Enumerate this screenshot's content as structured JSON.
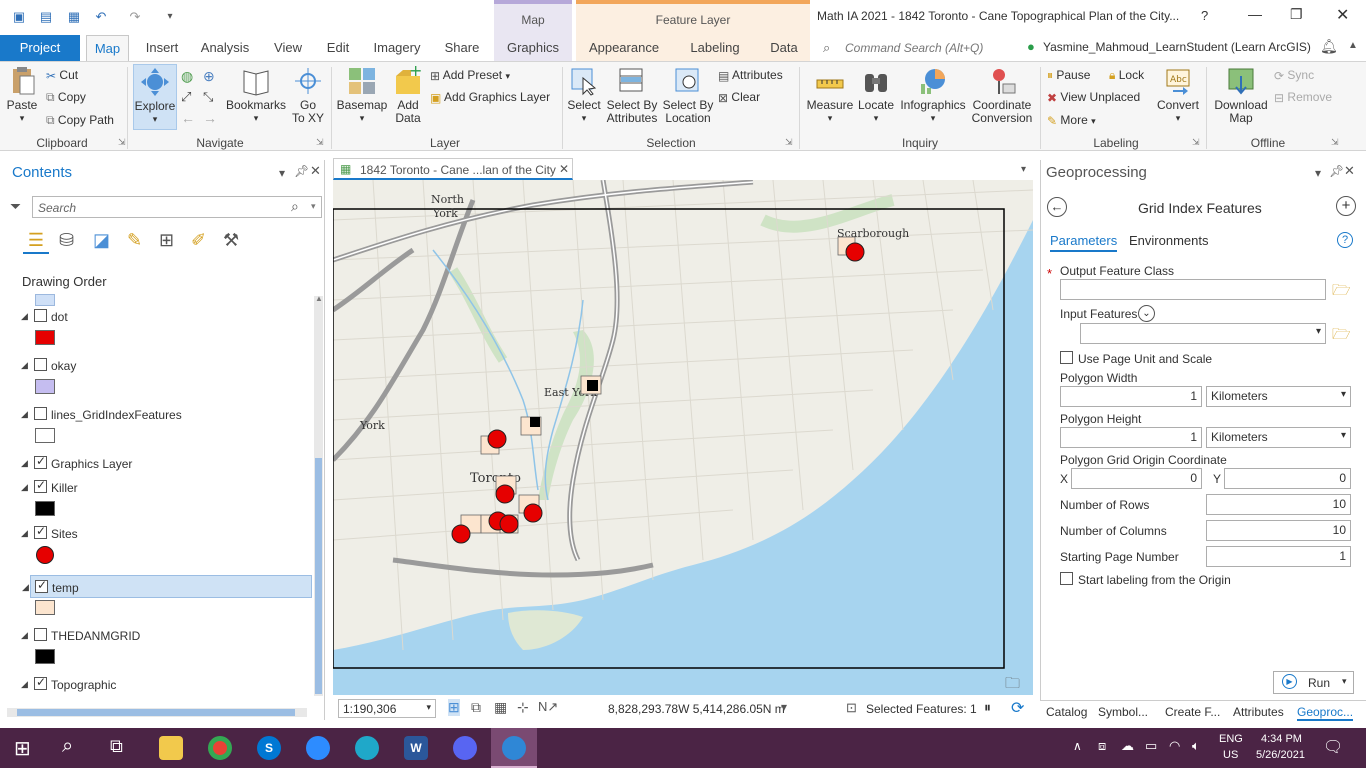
{
  "titlebar": {
    "context_map": "Map",
    "context_feature": "Feature Layer",
    "title": "Math IA 2021 - 1842 Toronto - Cane Topographical Plan of the City...",
    "help": "?"
  },
  "tabs": {
    "project": "Project",
    "map": "Map",
    "insert": "Insert",
    "analysis": "Analysis",
    "view": "View",
    "edit": "Edit",
    "imagery": "Imagery",
    "share": "Share",
    "graphics": "Graphics",
    "appearance": "Appearance",
    "labeling": "Labeling",
    "data": "Data"
  },
  "search": {
    "placeholder": "Command Search (Alt+Q)"
  },
  "user": {
    "name": "Yasmine_Mahmoud_LearnStudent (Learn ArcGIS)"
  },
  "ribbon": {
    "clipboard": {
      "paste": "Paste",
      "cut": "Cut",
      "copy": "Copy",
      "copy_path": "Copy Path",
      "group": "Clipboard"
    },
    "navigate": {
      "explore": "Explore",
      "bookmarks": "Bookmarks",
      "goto1": "Go",
      "goto2": "To XY",
      "group": "Navigate"
    },
    "layer": {
      "basemap": "Basemap",
      "add1": "Add",
      "add2": "Data",
      "add_preset": "Add Preset",
      "add_graphics": "Add Graphics Layer",
      "group": "Layer"
    },
    "selection": {
      "select": "Select",
      "sba1": "Select By",
      "sba2": "Attributes",
      "sbl1": "Select By",
      "sbl2": "Location",
      "attributes": "Attributes",
      "clear": "Clear",
      "group": "Selection"
    },
    "inquiry": {
      "measure": "Measure",
      "locate": "Locate",
      "infographics": "Infographics",
      "coord1": "Coordinate",
      "coord2": "Conversion",
      "group": "Inquiry"
    },
    "labeling": {
      "pause": "Pause",
      "lock": "Lock",
      "view_unplaced": "View Unplaced",
      "more": "More",
      "convert": "Convert",
      "group": "Labeling"
    },
    "offline": {
      "download1": "Download",
      "download2": "Map",
      "sync": "Sync",
      "remove": "Remove",
      "group": "Offline"
    }
  },
  "contents": {
    "title": "Contents",
    "search_placeholder": "Search",
    "drawing_order": "Drawing Order",
    "layers": [
      {
        "name": "dot",
        "checked": false,
        "swatch": "#e60000"
      },
      {
        "name": "okay",
        "checked": false,
        "swatch": "#c5bdf0"
      },
      {
        "name": "lines_GridIndexFeatures",
        "checked": false,
        "swatch": "#ffffff"
      },
      {
        "name": "Graphics Layer",
        "checked": true
      },
      {
        "name": "Killer",
        "checked": true,
        "swatch": "#000000"
      },
      {
        "name": "Sites",
        "checked": true,
        "swatch": "#e60000"
      },
      {
        "name": "temp",
        "checked": true,
        "swatch": "#fce5cf"
      },
      {
        "name": "THEDANMGRID",
        "checked": false,
        "swatch": "#000000"
      },
      {
        "name": "Topographic",
        "checked": true
      }
    ]
  },
  "mapview": {
    "tab_label": "1842 Toronto - Cane ...lan of the City",
    "scale": "1:190,306",
    "coords": "8,828,293.78W 5,414,286.05N m",
    "selected": "Selected Features: 1",
    "labels": {
      "north_york1": "North",
      "north_york2": "York",
      "scarborough": "Scarborough",
      "east_york": "East York",
      "york": "York",
      "toronto": "Toronto"
    }
  },
  "geoprocessing": {
    "title": "Geoprocessing",
    "tool": "Grid Index Features",
    "tab_params": "Parameters",
    "tab_env": "Environments",
    "output_label": "Output Feature Class",
    "input_label": "Input Features",
    "use_page": "Use Page Unit and Scale",
    "poly_width_label": "Polygon Width",
    "poly_width": "1",
    "poly_width_unit": "Kilometers",
    "poly_height_label": "Polygon Height",
    "poly_height": "1",
    "poly_height_unit": "Kilometers",
    "origin_label": "Polygon Grid Origin Coordinate",
    "x_label": "X",
    "x_val": "0",
    "y_label": "Y",
    "y_val": "0",
    "rows_label": "Number of Rows",
    "rows": "10",
    "cols_label": "Number of Columns",
    "cols": "10",
    "start_label": "Starting Page Number",
    "start": "1",
    "label_origin": "Start labeling from the Origin",
    "run": "Run"
  },
  "bottom_tabs": [
    "Catalog",
    "Symbol...",
    "Create F...",
    "Attributes",
    "Geoproc..."
  ],
  "taskbar": {
    "lang1": "ENG",
    "lang2": "US",
    "time": "4:34 PM",
    "date": "5/26/2021"
  }
}
